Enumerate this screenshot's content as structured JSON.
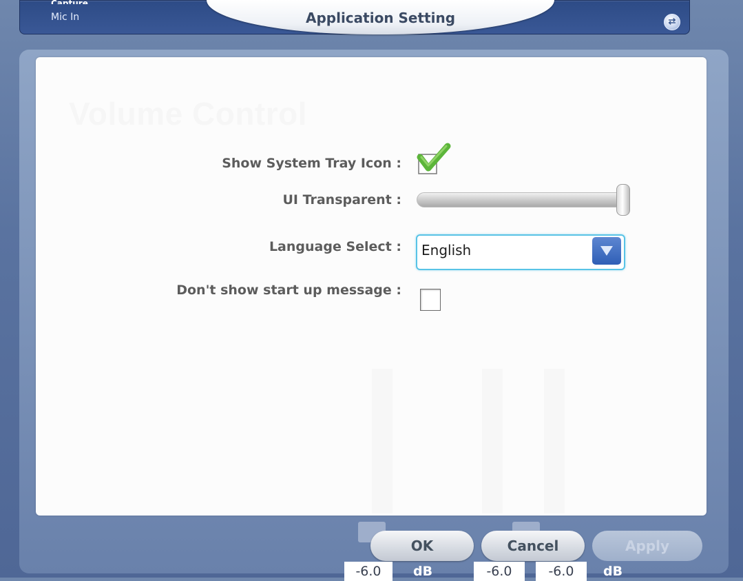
{
  "header": {
    "device_label": "Mic In",
    "cut_label": "Capture",
    "title": "Application Setting",
    "icon": "swap-arrows-icon"
  },
  "background": {
    "ghost_heading": "Volume Control"
  },
  "settings": {
    "tray_icon": {
      "label": "Show System Tray Icon :",
      "checked": true,
      "icon": "checkmark-icon"
    },
    "ui_transparent": {
      "label": "UI Transparent :",
      "level": 1.0
    },
    "language": {
      "label": "Language Select :",
      "value": "English",
      "icon": "dropdown-arrow-icon"
    },
    "startup_message": {
      "label": "Don't show start up message :",
      "checked": false
    }
  },
  "buttons": {
    "ok": "OK",
    "cancel": "Cancel",
    "apply": "Apply"
  },
  "readouts": {
    "left_value": "-6.0",
    "left_unit": "dB",
    "right_value_1": "-6.0",
    "right_value_2": "-6.0",
    "right_unit": "dB"
  },
  "colors": {
    "accent_select_border": "#58c3e6",
    "checkmark_green": "#5cb53a",
    "dropdown_blue": "#2f5fb6"
  }
}
